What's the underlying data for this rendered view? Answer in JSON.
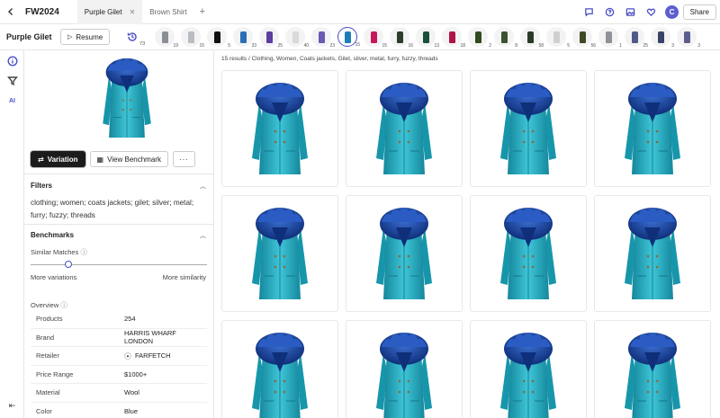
{
  "header": {
    "project_name": "FW2024",
    "tabs": [
      {
        "label": "Purple Gilet",
        "closable": true
      },
      {
        "label": "Brown Shirt",
        "closable": false
      }
    ],
    "avatar_initial": "C",
    "share_label": "Share",
    "icons": [
      "chat-icon",
      "help-icon",
      "gallery-icon",
      "heart-icon"
    ]
  },
  "subbar": {
    "title": "Purple Gilet",
    "resume_label": "Resume",
    "history_count": "73",
    "thumbnails": [
      {
        "count": "19",
        "color": "#8a8f96"
      },
      {
        "count": "15",
        "color": "#b9bcc0"
      },
      {
        "count": "5",
        "color": "#111111"
      },
      {
        "count": "33",
        "color": "#2b6fb6"
      },
      {
        "count": "25",
        "color": "#5a3fa0"
      },
      {
        "count": "40",
        "color": "#d9d9d9"
      },
      {
        "count": "23",
        "color": "#6b58b5"
      },
      {
        "count": "15",
        "color": "#1e7fb8"
      },
      {
        "count": "15",
        "color": "#c8175b"
      },
      {
        "count": "16",
        "color": "#2c3e2a"
      },
      {
        "count": "13",
        "color": "#1a4f3a"
      },
      {
        "count": "18",
        "color": "#b0124a"
      },
      {
        "count": "2",
        "color": "#2e4a1e"
      },
      {
        "count": "8",
        "color": "#3b5230"
      },
      {
        "count": "58",
        "color": "#2a3a2a"
      },
      {
        "count": "5",
        "color": "#cfcfcf"
      },
      {
        "count": "56",
        "color": "#3d4a25"
      },
      {
        "count": "1",
        "color": "#8e9298"
      },
      {
        "count": "25",
        "color": "#4e5a8a"
      },
      {
        "count": "3",
        "color": "#3a4266"
      },
      {
        "count": "3",
        "color": "#5c5f8e"
      }
    ]
  },
  "rail": {
    "ai_label": "AI"
  },
  "panel": {
    "variation_label": "Variation",
    "benchmark_label": "View Benchmark",
    "more_label": "···",
    "filters_title": "Filters",
    "filters_text": "clothing; women; coats jackets; gilet; silver; metal; furry; fuzzy; threads",
    "benchmarks_title": "Benchmarks",
    "similar_label": "Similar Matches",
    "slider_left": "More variations",
    "slider_right": "More similarity",
    "slider_value": 0.2,
    "overview_label": "Overview",
    "overview": [
      {
        "key": "Products",
        "value": "254"
      },
      {
        "key": "Brand",
        "value": "HARRIS WHARF LONDON"
      },
      {
        "key": "Retailer",
        "value": "FARFETCH"
      },
      {
        "key": "Price Range",
        "value": "$1000+"
      },
      {
        "key": "Material",
        "value": "Wool"
      },
      {
        "key": "Color",
        "value": "Blue"
      }
    ]
  },
  "results": {
    "breadcrumb": "15 results / Clothing, Women, Coats jackets, Gilet, silver, metal, furry, fuzzy, threads",
    "colors": {
      "coat": "#27b3c9",
      "coat_dark": "#15879c",
      "fur": "#1d4fb0",
      "fur_dark": "#0f2f7a"
    }
  }
}
